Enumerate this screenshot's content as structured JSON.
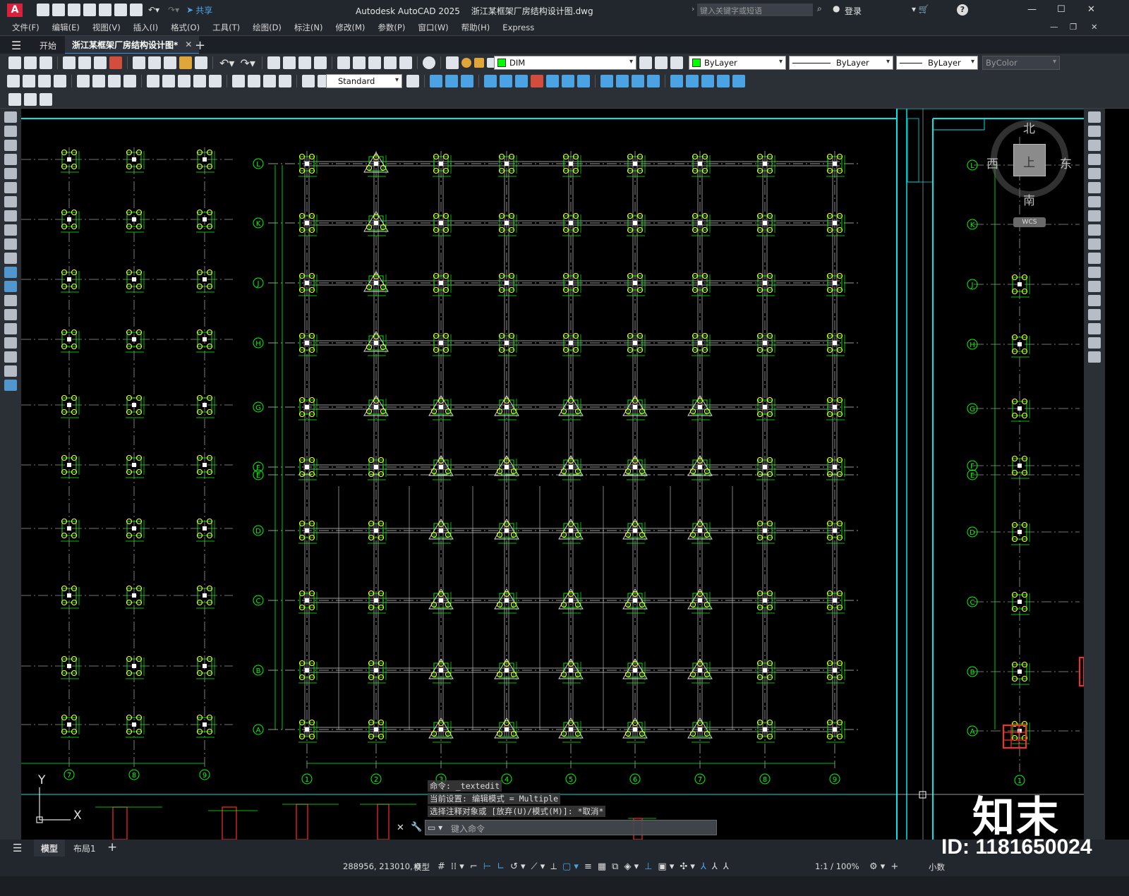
{
  "app": {
    "title": "Autodesk AutoCAD 2025",
    "file_name": "浙江某框架厂房结构设计图.dwg",
    "logo_letter": "A",
    "share_label": "共享",
    "search_placeholder": "键入关键字或短语",
    "login_label": "登录"
  },
  "menu": [
    "文件(F)",
    "编辑(E)",
    "视图(V)",
    "插入(I)",
    "格式(O)",
    "工具(T)",
    "绘图(D)",
    "标注(N)",
    "修改(M)",
    "参数(P)",
    "窗口(W)",
    "帮助(H)",
    "Express"
  ],
  "tabs": {
    "start": "开始",
    "active": "浙江某框架厂房结构设计图*",
    "add": "+"
  },
  "toolbar": {
    "layer_name": "DIM",
    "color": "ByLayer",
    "linetype": "ByLayer",
    "lineweight": "ByLayer",
    "plotstyle": "ByColor",
    "text_style": "Standard"
  },
  "viewcube": {
    "north": "北",
    "south": "南",
    "east": "东",
    "west": "西",
    "top": "上",
    "wcs": "WCS"
  },
  "drawing": {
    "axis_letters": [
      "L",
      "K",
      "J",
      "H",
      "G",
      "F",
      "E",
      "D",
      "C",
      "B",
      "A"
    ],
    "axis_numbers": [
      "1",
      "2",
      "3",
      "4",
      "5",
      "6",
      "7",
      "8",
      "9"
    ],
    "left_axis_numbers": [
      "7",
      "8",
      "9"
    ],
    "right_axis_number": "1",
    "ucs_x": "X",
    "ucs_y": "Y"
  },
  "command": {
    "history_1": "命令: _textedit",
    "history_2": "当前设置: 编辑模式 = Multiple",
    "history_3": "选择注释对象或 [放弃(U)/模式(M)]: *取消*",
    "input_placeholder": "键入命令"
  },
  "layout_tabs": [
    "模型",
    "布局1"
  ],
  "status": {
    "coordinates": "288956, 213010, 0",
    "space": "模型",
    "scale": "1:1 / 100%",
    "units": "小数"
  },
  "watermark": {
    "site_logo": "知末",
    "id_text": "ID: 1181650024"
  },
  "colors": {
    "background": "#000000",
    "cyan_border": "#00e5e5",
    "green_dim": "#00ff00",
    "yellow_column": "#ffff33",
    "red_element": "#ff2a2a",
    "grid_line": "#9a9a9a"
  }
}
